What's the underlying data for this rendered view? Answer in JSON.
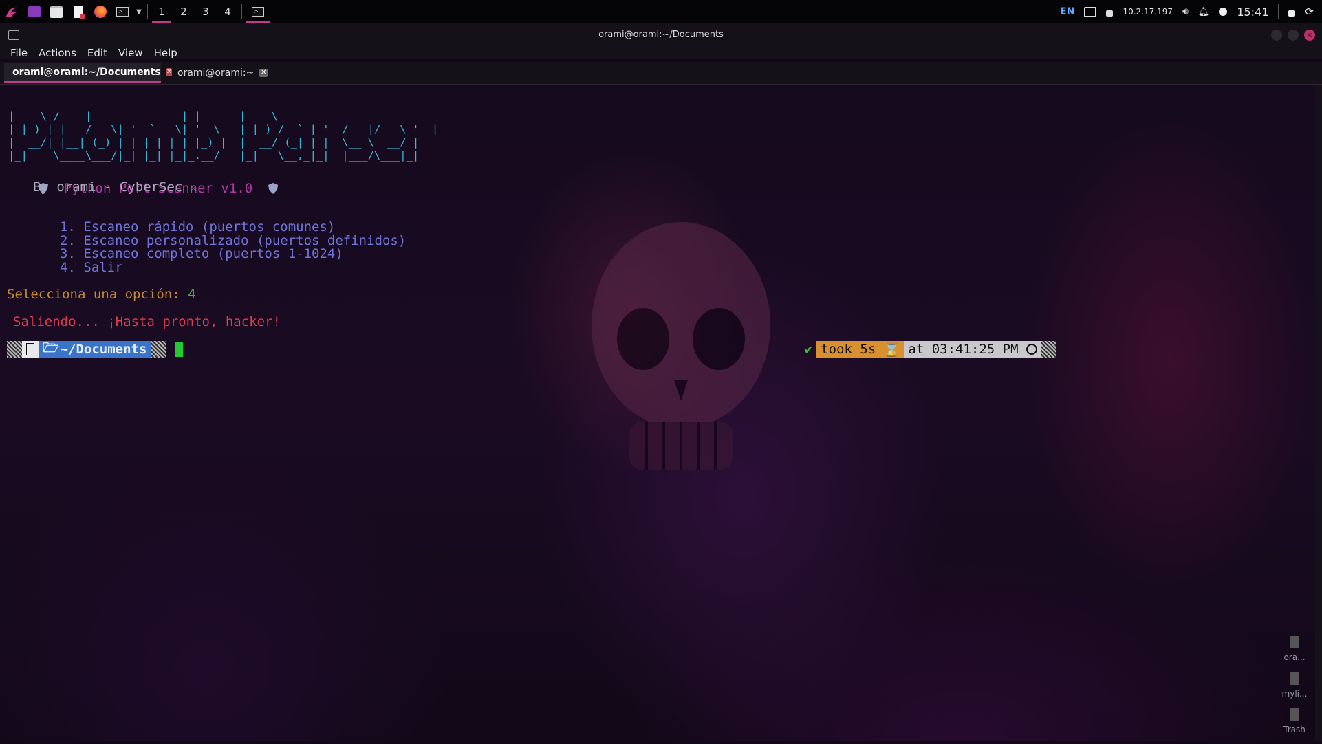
{
  "panel": {
    "workspaces": [
      "1",
      "2",
      "3",
      "4"
    ],
    "active_workspace": "1",
    "tray": {
      "language": "EN",
      "ip": "10.2.17.197",
      "clock": "15:41"
    }
  },
  "window": {
    "title": "orami@orami:~/Documents",
    "menu": [
      "File",
      "Actions",
      "Edit",
      "View",
      "Help"
    ],
    "tabs": [
      {
        "label": "orami@orami:~/Documents",
        "active": true
      },
      {
        "label": "orami@orami:~",
        "active": false
      }
    ]
  },
  "terminal": {
    "banner": " ____    ____                  _        ____                             \n|  _ \\ / ___|___  _ __ ___ | |__    |  _ \\ __ _ _ __ ___  ___ _ __ \n| |_) | |   / _ \\| '_ ` _ \\| '_ \\   | |_) / _` | '__/ __|/ _ \\ '__|\n|  __/| |__| (_) | | | | | | |_) |  |  __/ (_| | |  \\__ \\  __/ |   \n|_|    \\____\\___/|_| |_| |_|_.__/   |_|   \\__,_|_|  |___/\\___|_|   ",
    "title_line": "Python Port Scanner v1.0",
    "author_line": "By orami - CyberSec",
    "author_symbol": "⚔",
    "menu_items": [
      "1. Escaneo rápido (puertos comunes)",
      "2. Escaneo personalizado (puertos definidos)",
      "3. Escaneo completo (puertos 1-1024)",
      "4. Salir"
    ],
    "prompt_label": "Selecciona una opción: ",
    "prompt_answer": "4",
    "exit_message": "Saliendo... ¡Hasta pronto, hacker!",
    "ps1": {
      "path": "~/Documents",
      "status_check": "✔",
      "took": "took 5s",
      "time": "at 03:41:25 PM"
    }
  },
  "desktop_icons": [
    {
      "label": "ora..."
    },
    {
      "label": "myli..."
    },
    {
      "label": "Trash"
    }
  ],
  "colors": {
    "accent": "#c23a8f",
    "banner": "#38b8d8",
    "menu_text": "#6f73d8",
    "exit_text": "#e23b4e",
    "prompt_dir_bg": "#3a74c8",
    "took_bg": "#d9912f"
  }
}
